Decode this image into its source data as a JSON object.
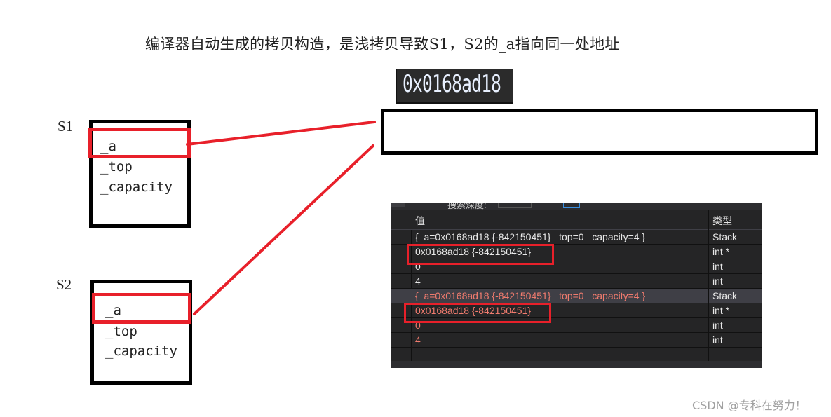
{
  "title": "编译器自动生成的拷贝构造，是浅拷贝导致S1，S2的_a指向同一处地址",
  "address_snippet": "0x0168ad18",
  "objects": [
    {
      "label": "S1",
      "fields": [
        "_a",
        "_top",
        "_capacity"
      ],
      "highlighted_field": "_a"
    },
    {
      "label": "S2",
      "fields": [
        "_a",
        "_top",
        "_capacity"
      ],
      "highlighted_field": "_a"
    }
  ],
  "highlight_color": "#e8202a",
  "debugger": {
    "toolbar_text": "搜索深度:",
    "columns": {
      "value": "值",
      "type": "类型"
    },
    "rows": [
      {
        "value": "{_a=0x0168ad18 {-842150451} _top=0 _capacity=4 }",
        "type": "Stack",
        "changed": false,
        "selected": false,
        "highlighted": false
      },
      {
        "value": "0x0168ad18 {-842150451}",
        "type": "int *",
        "changed": false,
        "selected": false,
        "highlighted": true
      },
      {
        "value": "0",
        "type": "int",
        "changed": false,
        "selected": false,
        "highlighted": false
      },
      {
        "value": "4",
        "type": "int",
        "changed": false,
        "selected": false,
        "highlighted": false
      },
      {
        "value": "{_a=0x0168ad18 {-842150451} _top=0 _capacity=4 }",
        "type": "Stack",
        "changed": true,
        "selected": true,
        "highlighted": false
      },
      {
        "value": "0x0168ad18 {-842150451}",
        "type": "int *",
        "changed": true,
        "selected": false,
        "highlighted": true
      },
      {
        "value": "0",
        "type": "int",
        "changed": true,
        "selected": false,
        "highlighted": false
      },
      {
        "value": "4",
        "type": "int",
        "changed": true,
        "selected": false,
        "highlighted": false
      },
      {
        "value": "",
        "type": "",
        "changed": false,
        "selected": false,
        "highlighted": false
      }
    ]
  },
  "watermark": "CSDN @专科在努力！"
}
